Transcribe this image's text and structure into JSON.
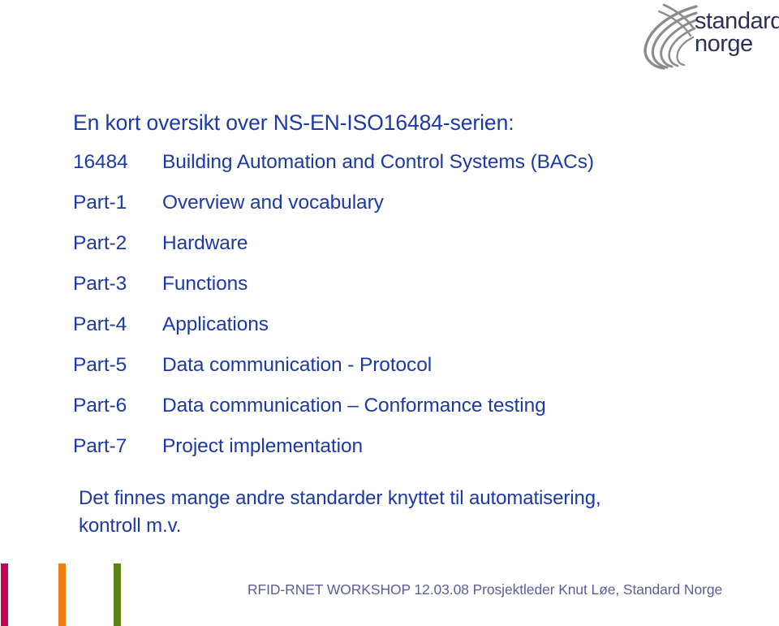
{
  "logo": {
    "mark_icon": "swoosh-arcs-icon",
    "line1": "standard",
    "line2": "norge"
  },
  "slide": {
    "title": "En kort oversikt over NS-EN-ISO16484-serien:",
    "rows": [
      {
        "label": "16484",
        "text": "Building Automation and Control Systems (BACs)"
      },
      {
        "label": "Part-1",
        "text": "Overview and vocabulary"
      },
      {
        "label": "Part-2",
        "text": "Hardware"
      },
      {
        "label": "Part-3",
        "text": "Functions"
      },
      {
        "label": "Part-4",
        "text": "Applications"
      },
      {
        "label": "Part-5",
        "text": "Data communication - Protocol"
      },
      {
        "label": "Part-6",
        "text": "Data communication – Conformance testing"
      },
      {
        "label": "Part-7",
        "text": "Project implementation"
      }
    ],
    "note_line1": "Det finnes mange andre standarder knyttet til automatisering,",
    "note_line2": "kontroll m.v."
  },
  "footer": {
    "text": "RFID-RNET WORKSHOP 12.03.08 Prosjektleder Knut Løe, Standard Norge"
  },
  "decor": {
    "bar_crimson_color": "#c2045a",
    "bar_orange_color": "#f07f11",
    "bar_green_color": "#5f8316"
  },
  "colors": {
    "body_blue": "#1c39a8",
    "logo_navy": "#2b3256",
    "footer_slate": "#5a5f99"
  }
}
